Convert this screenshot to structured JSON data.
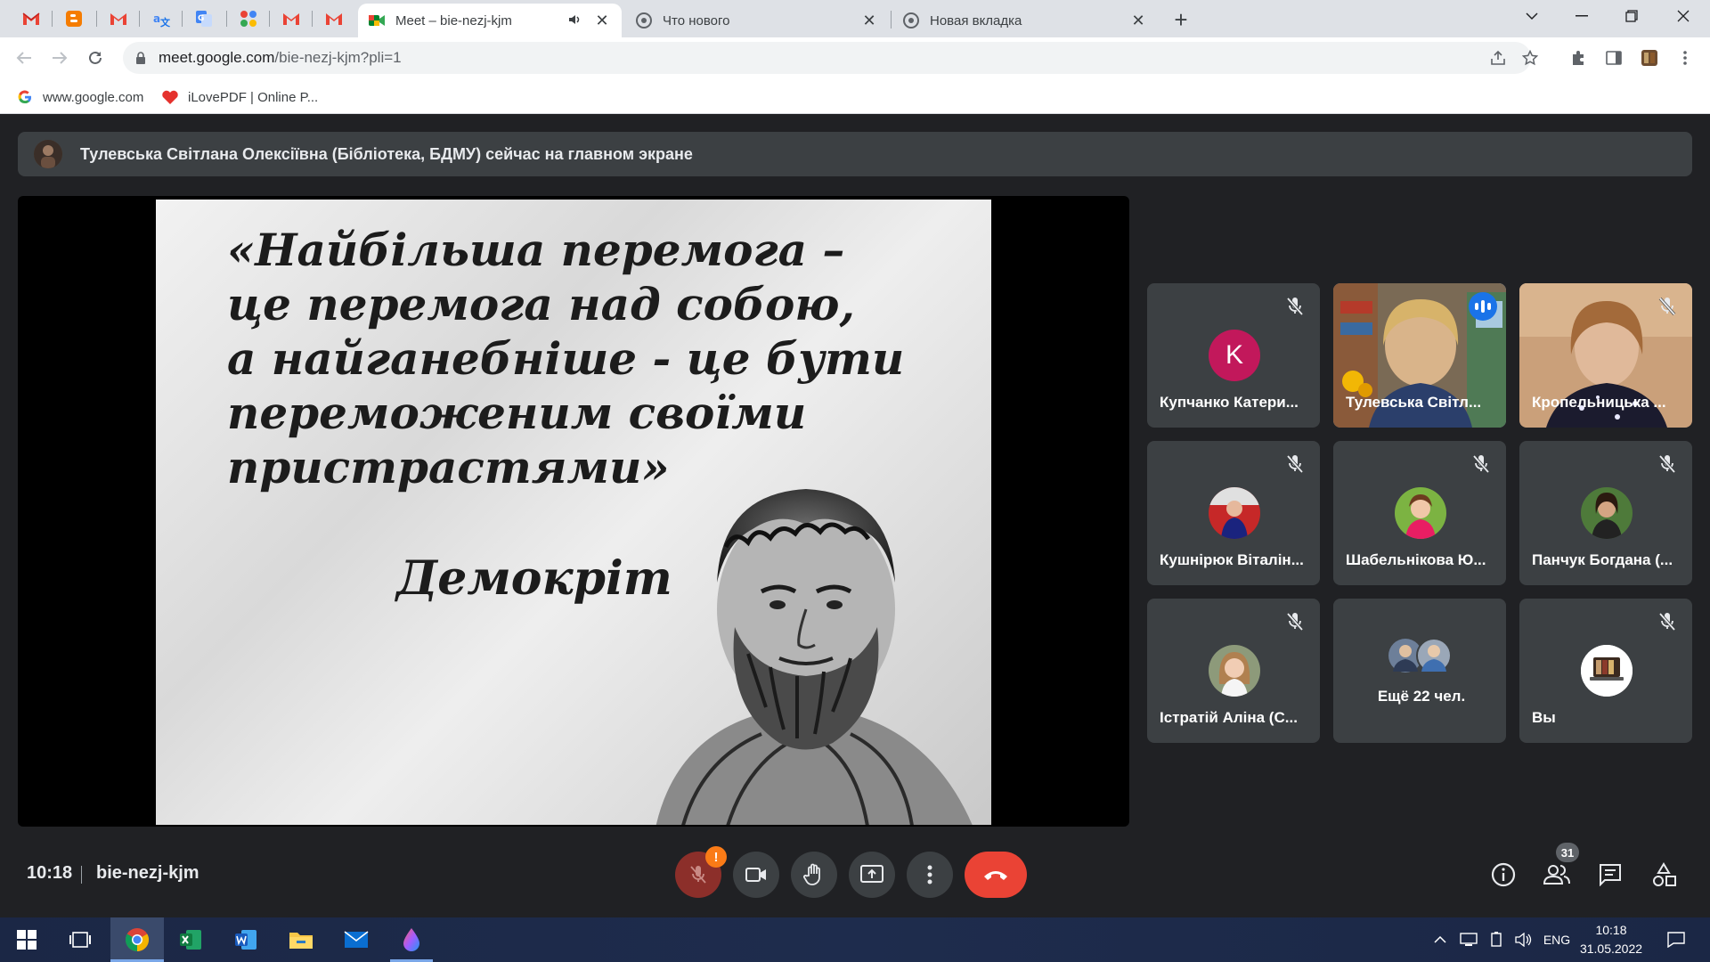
{
  "browser": {
    "tabs": [
      {
        "title": "Meet – bie-nezj-kjm",
        "active": true
      },
      {
        "title": "Что нового",
        "active": false
      },
      {
        "title": "Новая вкладка",
        "active": false
      }
    ],
    "url_host": "meet.google.com",
    "url_path": "/bie-nezj-kjm?pli=1",
    "bookmarks": [
      {
        "label": "www.google.com"
      },
      {
        "label": "iLovePDF | Online P..."
      }
    ]
  },
  "meet": {
    "banner_text": "Тулевська Світлана Олексіївна (Бібліотека, БДМУ) сейчас на главном экране",
    "slide": {
      "quote": "«Найбільша перемога –\nце перемога над собою,\nа найганебніше - це бути\nпереможеним своїми\nпристрастями»",
      "author": "Демокріт"
    },
    "participants": [
      {
        "name": "Купчанко Катери...",
        "avatar_letter": "K",
        "avatar_color": "#c2185b"
      },
      {
        "name": "Тулевська Світл..."
      },
      {
        "name": "Кропельницька ..."
      },
      {
        "name": "Кушнірюк Віталін..."
      },
      {
        "name": "Шабельнікова Ю..."
      },
      {
        "name": "Панчук Богдана (..."
      },
      {
        "name": "Істратій Аліна (С..."
      },
      {
        "name": "Ещё 22 чел."
      },
      {
        "name": "Вы"
      }
    ],
    "time": "10:18",
    "meeting_code": "bie-nezj-kjm",
    "mic_warning": "!",
    "participant_count": "31"
  },
  "taskbar": {
    "lang": "ENG",
    "time": "10:18",
    "date": "31.05.2022"
  },
  "colors": {
    "meet_bg": "#202124",
    "tile_bg": "#3c4043",
    "end_call": "#ea4335",
    "speaking": "#8ab4f8",
    "taskbar": "#1b2745"
  }
}
